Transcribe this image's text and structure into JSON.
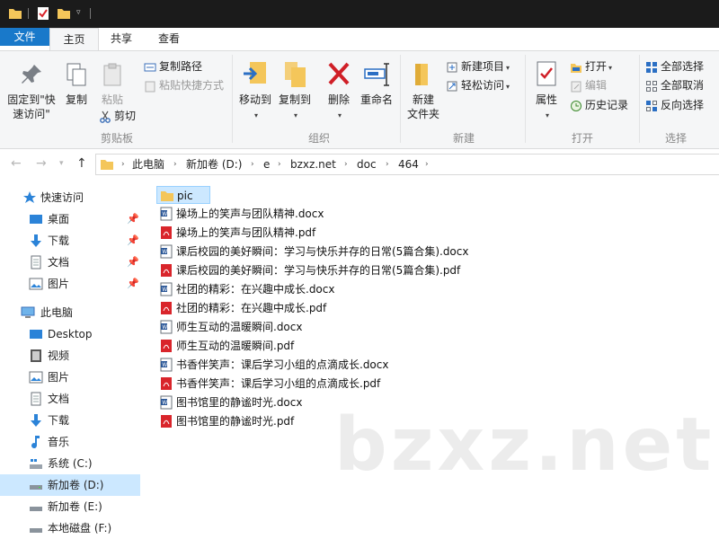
{
  "ribbon_tabs": {
    "file": "文件",
    "home": "主页",
    "share": "共享",
    "view": "查看"
  },
  "clipboard": {
    "pin_quick_access": "固定到\"快速访问\"",
    "copy": "复制",
    "paste": "粘贴",
    "copy_path": "复制路径",
    "paste_shortcut": "粘贴快捷方式",
    "cut": "剪切",
    "group_label": "剪贴板"
  },
  "organize": {
    "move_to": "移动到",
    "copy_to": "复制到",
    "delete": "删除",
    "rename": "重命名",
    "group_label": "组织"
  },
  "new_group": {
    "new_folder": "新建\n文件夹",
    "new_item": "新建项目",
    "easy_access": "轻松访问",
    "group_label": "新建"
  },
  "open_group": {
    "properties": "属性",
    "open": "打开",
    "edit": "编辑",
    "history": "历史记录",
    "group_label": "打开"
  },
  "select_group": {
    "select_all": "全部选择",
    "select_none": "全部取消",
    "invert_selection": "反向选择",
    "group_label": "选择"
  },
  "breadcrumb": [
    "此电脑",
    "新加卷 (D:)",
    "e",
    "bzxz.net",
    "doc",
    "464"
  ],
  "sidebar": {
    "quick_access": "快速访问",
    "quick_items": [
      "桌面",
      "下载",
      "文档",
      "图片"
    ],
    "this_pc": "此电脑",
    "pc_items": [
      "Desktop",
      "视频",
      "图片",
      "文档",
      "下载",
      "音乐",
      "系统 (C:)",
      "新加卷 (D:)",
      "新加卷 (E:)",
      "本地磁盘 (F:)"
    ]
  },
  "files": [
    {
      "name": "pic",
      "type": "folder"
    },
    {
      "name": "操场上的笑声与团队精神.docx",
      "type": "docx"
    },
    {
      "name": "操场上的笑声与团队精神.pdf",
      "type": "pdf"
    },
    {
      "name": "课后校园的美好瞬间：学习与快乐并存的日常(5篇合集).docx",
      "type": "docx"
    },
    {
      "name": "课后校园的美好瞬间：学习与快乐并存的日常(5篇合集).pdf",
      "type": "pdf"
    },
    {
      "name": "社团的精彩：在兴趣中成长.docx",
      "type": "docx"
    },
    {
      "name": "社团的精彩：在兴趣中成长.pdf",
      "type": "pdf"
    },
    {
      "name": "师生互动的温暖瞬间.docx",
      "type": "docx"
    },
    {
      "name": "师生互动的温暖瞬间.pdf",
      "type": "pdf"
    },
    {
      "name": "书香伴笑声：课后学习小组的点滴成长.docx",
      "type": "docx"
    },
    {
      "name": "书香伴笑声：课后学习小组的点滴成长.pdf",
      "type": "pdf"
    },
    {
      "name": "图书馆里的静谧时光.docx",
      "type": "docx"
    },
    {
      "name": "图书馆里的静谧时光.pdf",
      "type": "pdf"
    }
  ],
  "watermark": "bzxz.net",
  "colors": {
    "accent": "#1979ca",
    "selection": "#cce8ff",
    "folder": "#f4c65a",
    "pdf": "#d9252b",
    "word": "#2b5797"
  }
}
